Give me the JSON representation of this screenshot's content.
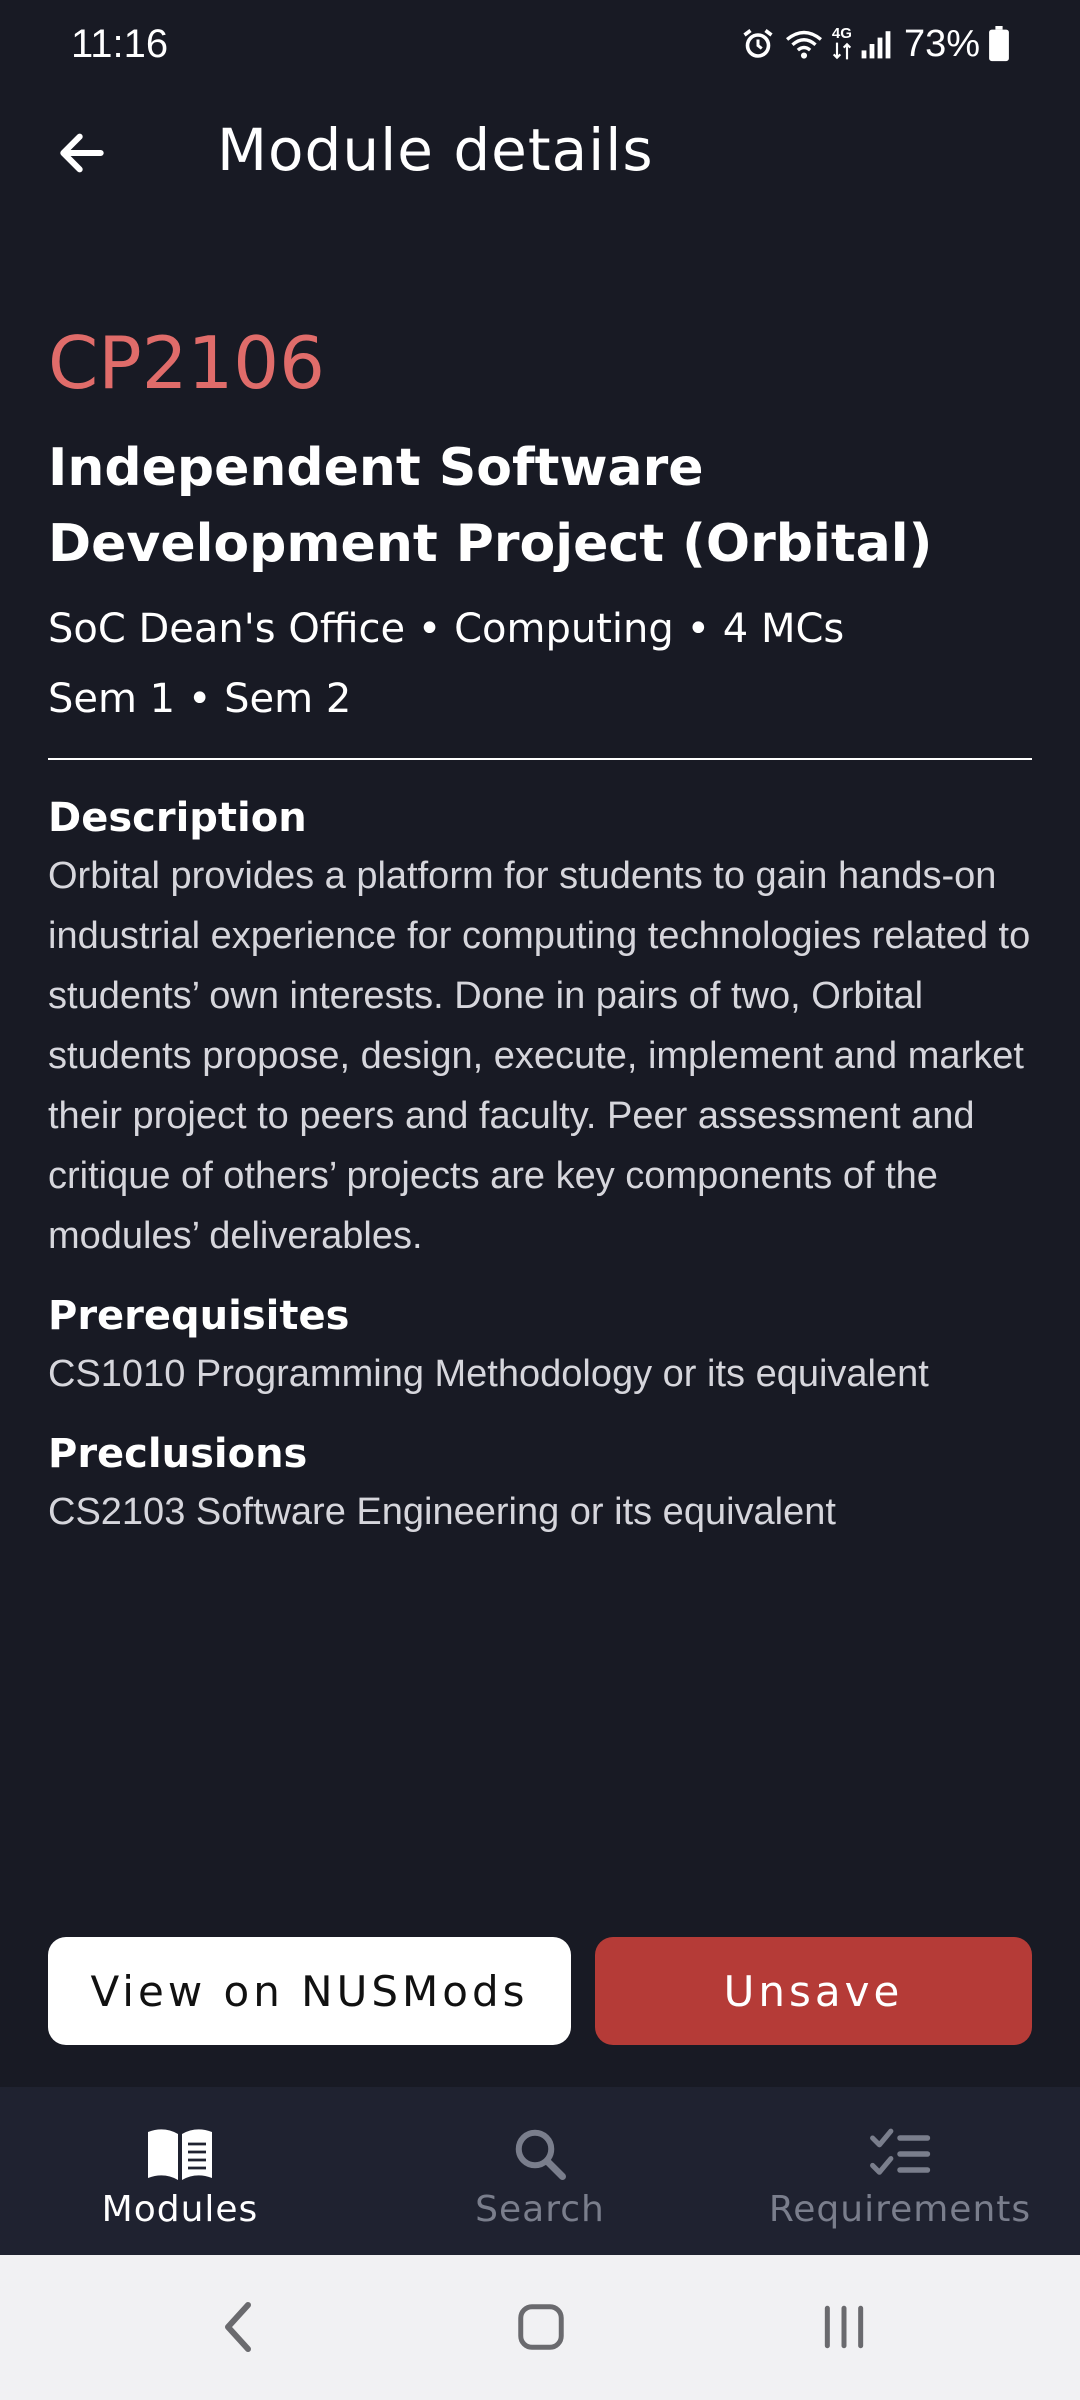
{
  "status_bar": {
    "time": "11:16",
    "network": "4G",
    "battery": "73%"
  },
  "app_bar": {
    "title": "Module details",
    "back_icon": "arrow-left-icon"
  },
  "module": {
    "code": "CP2106",
    "title": "Independent Software Development Project (Orbital)",
    "meta_line1": "SoC Dean's Office • Computing • 4 MCs",
    "meta_line2": "Sem 1 • Sem 2"
  },
  "sections": {
    "description_heading": "Description",
    "description_body": "Orbital provides a platform for students to gain hands-on industrial experience for computing technologies related to students’ own interests. Done in pairs of two, Orbital students propose, design, execute, implement and market their project to peers and faculty. Peer assessment and critique of others’ projects are key components of the modules’ deliverables.",
    "prerequisites_heading": "Prerequisites",
    "prerequisites_body": "CS1010 Programming Methodology or its equivalent",
    "preclusions_heading": "Preclusions",
    "preclusions_body": "CS2103 Software Engineering or its equivalent"
  },
  "actions": {
    "view_label": "View on NUSMods",
    "unsave_label": "Unsave"
  },
  "bottom_nav": {
    "items": [
      {
        "label": "Modules",
        "icon": "book-icon",
        "active": true
      },
      {
        "label": "Search",
        "icon": "search-icon",
        "active": false
      },
      {
        "label": "Requirements",
        "icon": "checklist-icon",
        "active": false
      }
    ]
  },
  "colors": {
    "background": "#181a24",
    "accent_code": "#e06c6a",
    "unsave_button": "#b53b37",
    "nav_background": "#1f2230",
    "nav_inactive": "#7a7e8c"
  }
}
